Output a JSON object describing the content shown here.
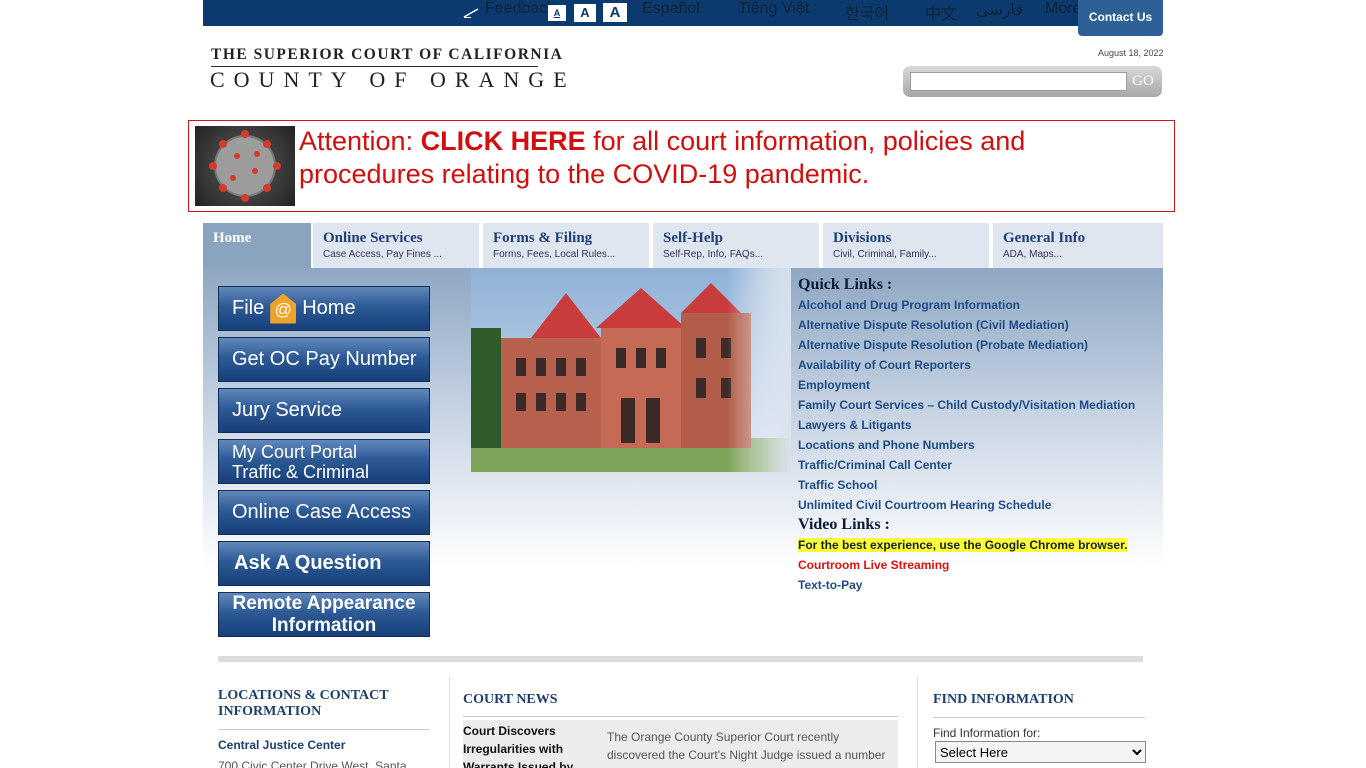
{
  "topbar": {
    "feedback": "Feedback",
    "font_small": "A",
    "font_medium": "A",
    "font_large": "A",
    "lang_es": "Español",
    "lang_vi": "Tiếng Việt",
    "lang_ko": "한국어",
    "lang_zh": "中文",
    "lang_fa": "فارسی",
    "more": "More",
    "contact": "Contact Us"
  },
  "header": {
    "logo_line1": "THE SUPERIOR COURT OF CALIFORNIA",
    "logo_line2": "COUNTY OF ORANGE",
    "date": "August 18, 2022",
    "search_placeholder": "",
    "search_go": "GO"
  },
  "covid": {
    "prefix": "Attention: ",
    "link": "CLICK HERE",
    "suffix": " for all court information, policies and procedures relating to the COVID-19 pandemic."
  },
  "nav": {
    "tabs": [
      {
        "title": "Home",
        "sub": ""
      },
      {
        "title": "Online Services",
        "sub": "Case Access, Pay Fines ..."
      },
      {
        "title": "Forms & Filing",
        "sub": "Forms, Fees, Local Rules..."
      },
      {
        "title": "Self-Help",
        "sub": "Self-Rep, Info, FAQs..."
      },
      {
        "title": "Divisions",
        "sub": "Civil, Criminal, Family..."
      },
      {
        "title": "General Info",
        "sub": "ADA, Maps..."
      }
    ]
  },
  "buttons": {
    "file_home_a": "File",
    "file_home_icon": "@",
    "file_home_b": "Home",
    "oc_pay": "Get OC Pay Number",
    "jury": "Jury Service",
    "portal_1": "My Court Portal",
    "portal_2": "Traffic & Criminal",
    "case_access": "Online Case Access",
    "ask": "Ask A Question",
    "remote_1": "Remote Appearance",
    "remote_2": "Information"
  },
  "quick_links": {
    "title": "Quick Links :",
    "items": [
      "Alcohol and Drug Program Information",
      "Alternative Dispute Resolution (Civil Mediation)",
      "Alternative Dispute Resolution (Probate Mediation)",
      "Availability of Court Reporters",
      "Employment",
      "Family Court Services – Child Custody/Visitation Mediation",
      "Lawyers & Litigants",
      "Locations and Phone Numbers",
      "Traffic/Criminal Call Center",
      "Traffic School",
      "Unlimited Civil Courtroom Hearing Schedule"
    ]
  },
  "video_links": {
    "title": "Video Links :",
    "notice": "For the best experience, use the Google Chrome browser.",
    "streaming": "Courtroom Live Streaming",
    "text_to_pay": "Text-to-Pay"
  },
  "locations": {
    "heading_1": "LOCATIONS & CONTACT",
    "heading_2": "INFORMATION",
    "center": "Central Justice Center",
    "address": "700 Civic Center Drive West, Santa"
  },
  "news": {
    "heading": "COURT NEWS",
    "headline_1": "Court Discovers",
    "headline_2": "Irregularities with",
    "headline_3": "Warrants Issued by",
    "body_1": "The Orange County Superior Court recently",
    "body_2": "discovered the Court's Night Judge issued a number"
  },
  "find": {
    "heading": "FIND INFORMATION",
    "label": "Find Information for:",
    "select": "Select Here"
  }
}
